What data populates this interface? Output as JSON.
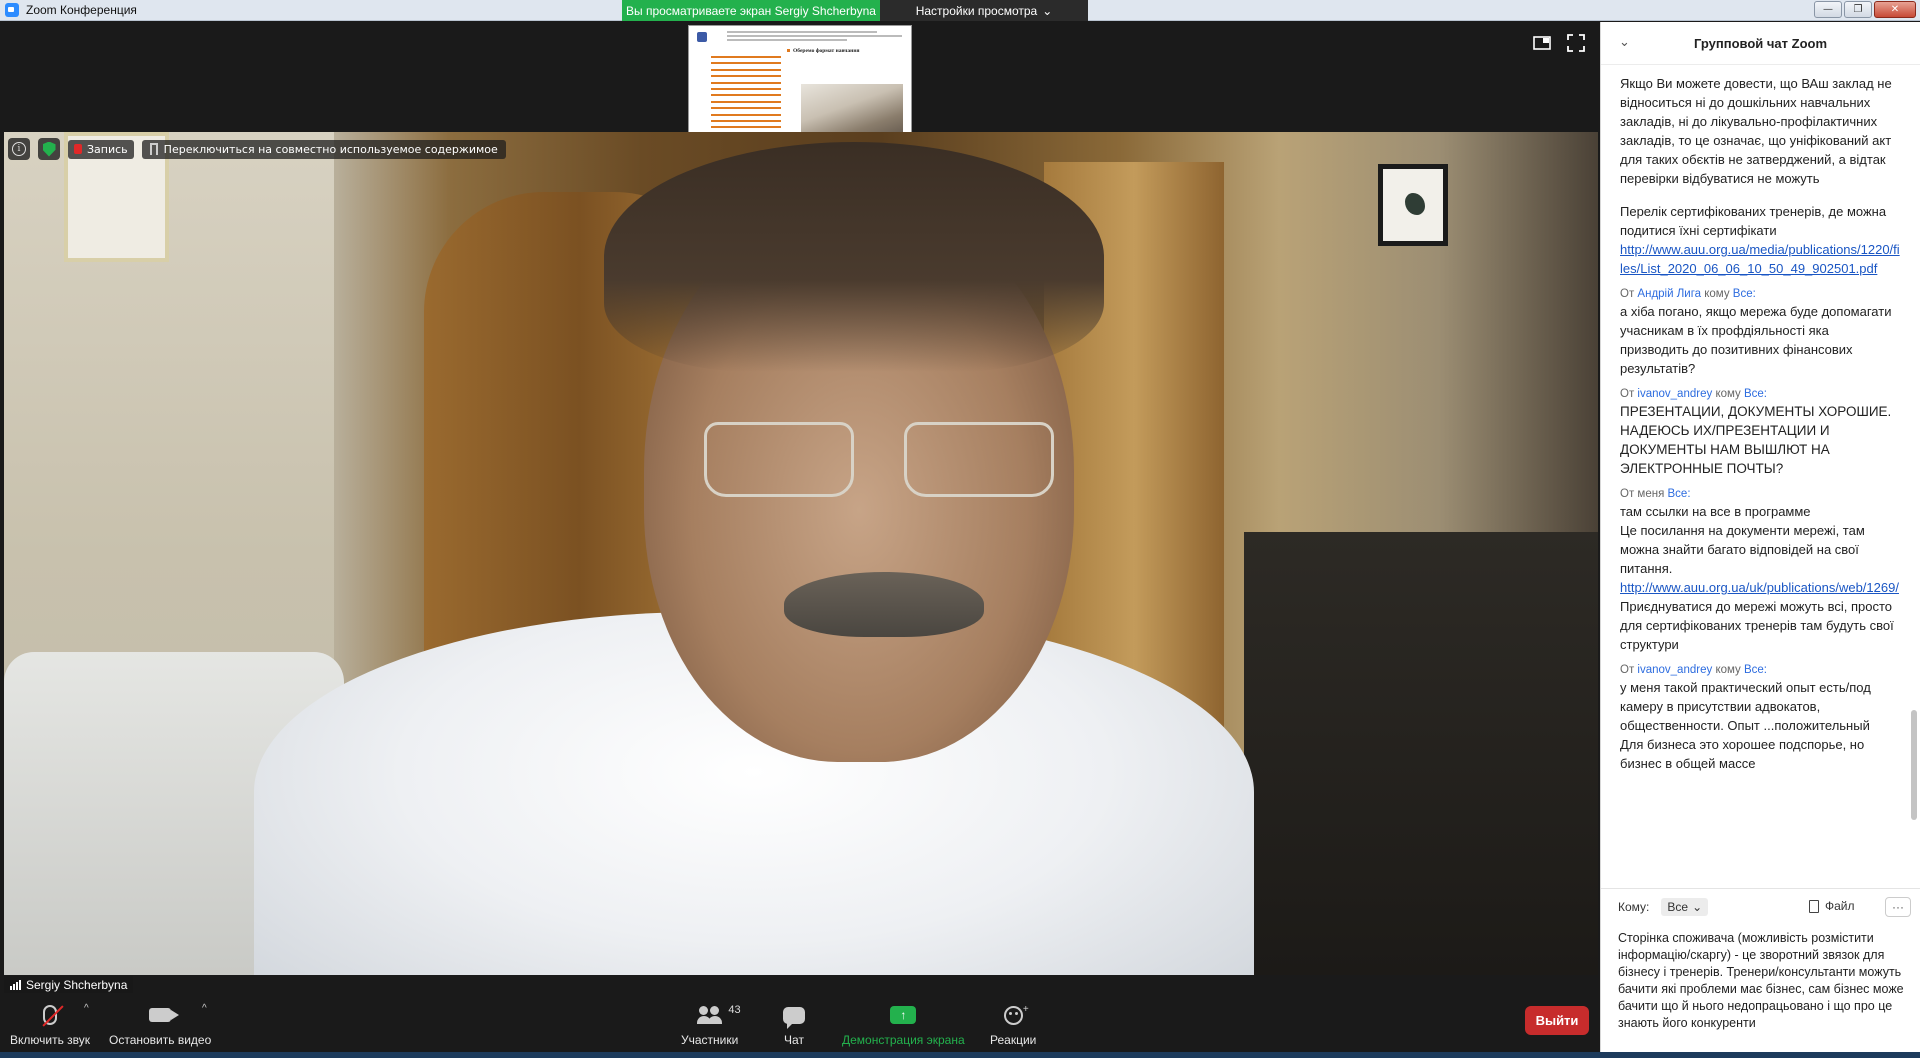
{
  "window": {
    "title": "Zoom Конференция",
    "viewing_banner": "Вы просматриваете экран Sergiy Shcherbyna",
    "view_options": "Настройки просмотра",
    "min": "—",
    "max": "❐",
    "close": "✕"
  },
  "share_thumbnail": {
    "heading": "Оберемо формат навчання"
  },
  "video": {
    "info": "i",
    "record_label": "Запись",
    "switch_label": "Переключиться на совместно используемое содержимое",
    "participant_name": "Sergiy Shcherbyna"
  },
  "toolbar": {
    "unmute_label": "Включить звук",
    "stop_video_label": "Остановить видео",
    "participants_label": "Участники",
    "participants_count": "43",
    "chat_label": "Чат",
    "share_label": "Демонстрация экрана",
    "reactions_label": "Реакции",
    "leave_label": "Выйти",
    "caret": "^"
  },
  "chat": {
    "title": "Групповой чат Zoom",
    "from_prefix": "От",
    "to_prefix": "кому",
    "messages": [
      {
        "lines": [
          "Якщо Ви можете довести, що ВАш заклад не відноситься ні до дошкільних навчальних закладів, ні до лікувально-профілактичних закладів, то це означає, що уніфікований акт для таких обєктів не затверджений, а відтак перевірки відбуватися не можуть"
        ]
      },
      {
        "lines": [
          "Перелік сертифікованих тренерів, де можна подитися їхні сертифікати"
        ],
        "link": "http://www.auu.org.ua/media/publications/1220/files/List_2020_06_06_10_50_49_902501.pdf"
      },
      {
        "from": "Андрій Лига",
        "to": "Все:",
        "lines": [
          "а хіба погано, якщо мережа буде допомагати учасникам в їх профдіяльності яка призводить до позитивних фінансових результатів?"
        ]
      },
      {
        "from": "ivanov_andrey",
        "to": "Все:",
        "lines": [
          "ПРЕЗЕНТАЦИИ, ДОКУМЕНТЫ ХОРОШИЕ. НАДЕЮСЬ ИХ/ПРЕЗЕНТАЦИИ И ДОКУМЕНТЫ НАМ ВЫШЛЮТ НА ЭЛЕКТРОННЫЕ ПОЧТЫ?"
        ]
      },
      {
        "from": "меня",
        "to": "Все:",
        "lines": [
          "там ссылки на все в программе",
          "Це посилання на документи мережі, там можна знайти багато відповідей на свої питання."
        ],
        "link": "http://www.auu.org.ua/uk/publications/web/1269/",
        "after_link": " Приєднуватися до мережі можуть всі, просто для сертифікованих тренерів там будуть свої структури"
      },
      {
        "from": "ivanov_andrey",
        "to": "Все:",
        "lines": [
          "у меня такой практический опыт есть/под камеру в присутствии адвокатов, общественности. Опыт ...положительный",
          "Для бизнеса это хорошее подспорье, но бизнес в общей массе"
        ]
      }
    ],
    "footer": {
      "to_label": "Кому:",
      "to_value": "Все",
      "file_label": "Файл",
      "more": "···"
    },
    "input_text": "Сторінка споживача (можливість розмістити інформацію/скаргу) - це зворотний звязок для бізнесу і тренерів. Тренери/консультанти можуть бачити які проблеми має бізнес, сам бізнес може бачити що й нього недопрацьовано і що про це знають його конкуренти"
  },
  "colors": {
    "banner_green": "#23b14d",
    "leave_red": "#c72c2c",
    "link_blue": "#1a56c4"
  }
}
